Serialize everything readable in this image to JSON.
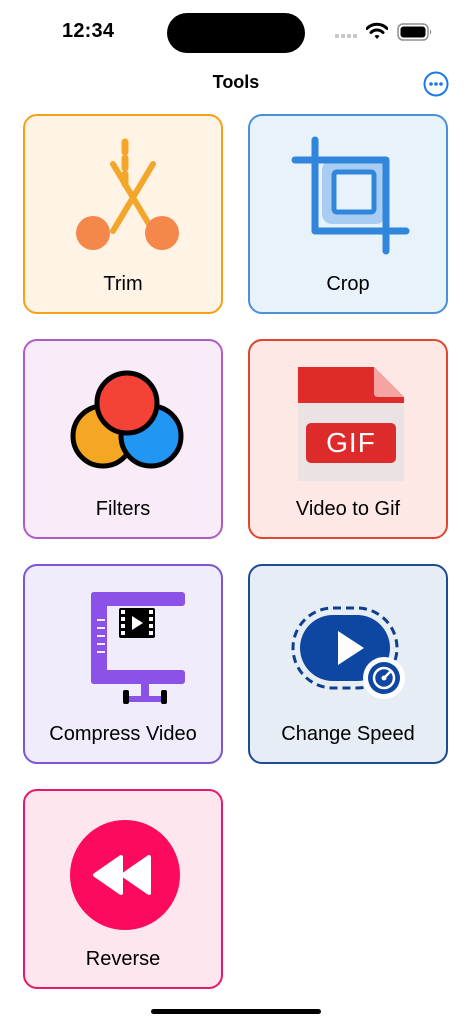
{
  "status_bar": {
    "time": "12:34"
  },
  "nav": {
    "title": "Tools",
    "more_icon": "ellipsis-circle-icon",
    "accent": "#1a7ae6"
  },
  "tools": [
    {
      "label": "Trim",
      "icon": "scissors-icon",
      "border": "#f5a01a",
      "fill": "#fff3e6"
    },
    {
      "label": "Crop",
      "icon": "crop-icon",
      "border": "#4a90d9",
      "fill": "#e8f2fb"
    },
    {
      "label": "Filters",
      "icon": "color-circles-icon",
      "border": "#b05cc7",
      "fill": "#f7ecf8"
    },
    {
      "label": "Video to Gif",
      "icon": "gif-file-icon",
      "border": "#e0452d",
      "fill": "#fde8e5"
    },
    {
      "label": "Compress Video",
      "icon": "clamp-compress-icon",
      "border": "#7a55d6",
      "fill": "#f0ecfb"
    },
    {
      "label": "Change Speed",
      "icon": "speed-play-icon",
      "border": "#1e4a96",
      "fill": "#e6edf5"
    },
    {
      "label": "Reverse",
      "icon": "rewind-icon",
      "border": "#e5186a",
      "fill": "#fde6ee"
    }
  ]
}
